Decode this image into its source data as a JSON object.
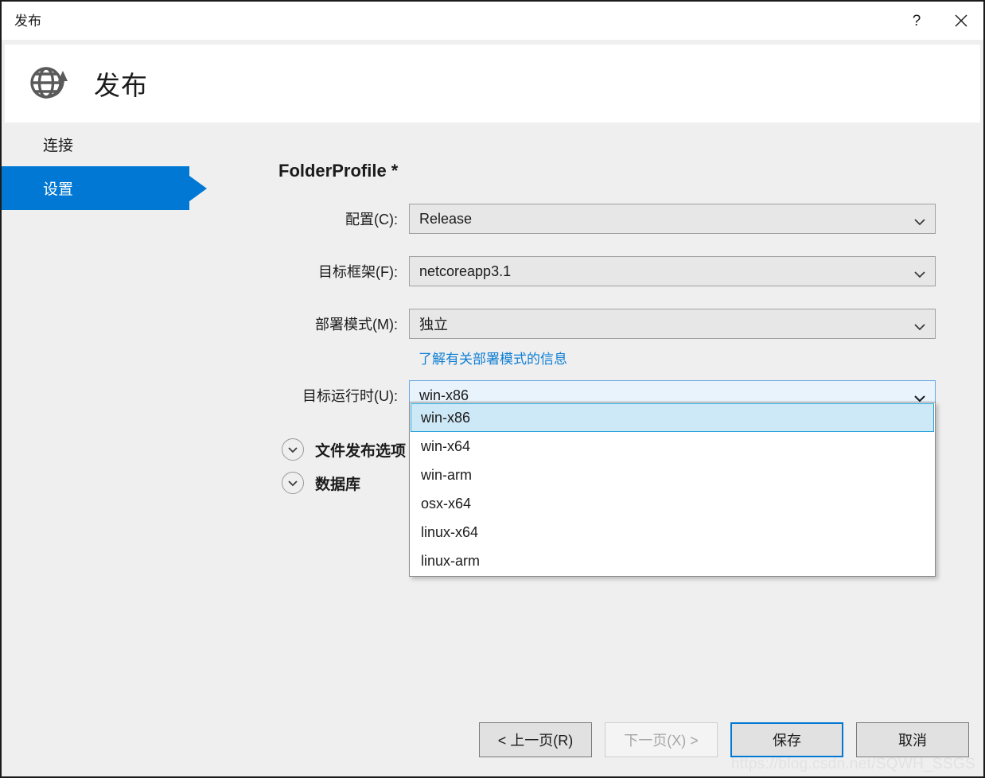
{
  "window": {
    "title": "发布",
    "help_label": "?",
    "close_label": "✕",
    "help_icon": "question-mark-icon",
    "close_icon": "close-icon"
  },
  "header": {
    "title": "发布",
    "icon": "publish-globe-icon"
  },
  "sidebar": {
    "items": [
      {
        "label": "连接",
        "selected": false
      },
      {
        "label": "设置",
        "selected": true
      }
    ]
  },
  "main": {
    "profile_title": "FolderProfile *",
    "fields": [
      {
        "label": "配置(C):",
        "value": "Release",
        "active": false
      },
      {
        "label": "目标框架(F):",
        "value": "netcoreapp3.1",
        "active": false
      },
      {
        "label": "部署模式(M):",
        "value": "独立",
        "active": false
      },
      {
        "label": "目标运行时(U):",
        "value": "win-x86",
        "active": true
      }
    ],
    "deployment_link": "了解有关部署模式的信息",
    "runtime_options": [
      {
        "label": "win-x86",
        "highlighted": true
      },
      {
        "label": "win-x64",
        "highlighted": false
      },
      {
        "label": "win-arm",
        "highlighted": false
      },
      {
        "label": "osx-x64",
        "highlighted": false
      },
      {
        "label": "linux-x64",
        "highlighted": false
      },
      {
        "label": "linux-arm",
        "highlighted": false
      }
    ],
    "expanders": [
      {
        "label": "文件发布选项",
        "icon": "chevron-down-circle-icon"
      },
      {
        "label": "数据库",
        "icon": "chevron-down-circle-icon"
      }
    ]
  },
  "footer": {
    "buttons": [
      {
        "label": "< 上一页(R)",
        "state": "normal"
      },
      {
        "label": "下一页(X) >",
        "state": "disabled"
      },
      {
        "label": "保存",
        "state": "default"
      },
      {
        "label": "取消",
        "state": "normal"
      }
    ]
  },
  "watermark": {
    "text": "https://blog.csdn.net/SQWH_SSGS"
  },
  "colors": {
    "accent": "#0078d4",
    "link": "#0f7fd4",
    "highlight_fill": "#cde8f6",
    "highlight_border": "#26a0da",
    "body_bg": "#efeff0",
    "control_bg": "#e7e7e7"
  }
}
